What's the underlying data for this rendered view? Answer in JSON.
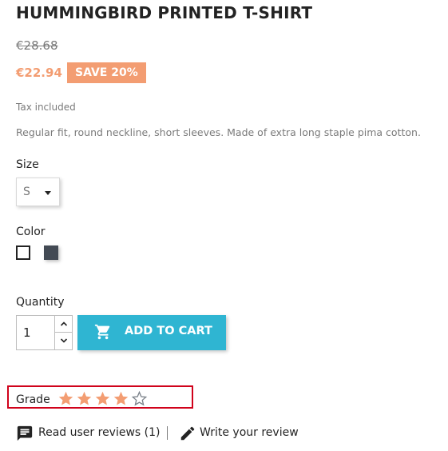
{
  "product": {
    "title": "HUMMINGBIRD PRINTED T-SHIRT",
    "old_price": "€28.68",
    "price": "€22.94",
    "discount": "SAVE 20%",
    "tax_note": "Tax included",
    "description": "Regular fit, round neckline, short sleeves. Made of extra long staple pima cotton."
  },
  "size": {
    "label": "Size",
    "selected": "S"
  },
  "color": {
    "label": "Color",
    "swatches": [
      {
        "name": "white",
        "hex": "#ffffff",
        "selected": true
      },
      {
        "name": "gray",
        "hex": "#434a54",
        "selected": false
      }
    ]
  },
  "quantity": {
    "label": "Quantity",
    "value": "1"
  },
  "cart": {
    "label": "ADD TO CART",
    "icon": "shopping-cart-icon",
    "color": "#2fb5d2"
  },
  "rating": {
    "label": "Grade",
    "value": 4,
    "max": 5,
    "star_color": "#f39d72"
  },
  "reviews": {
    "read_label": "Read user reviews (1)",
    "write_label": "Write your review",
    "read_icon": "comment-icon",
    "write_icon": "pencil-icon"
  },
  "colors": {
    "accent": "#2fb5d2",
    "discount": "#f39d72",
    "highlight_border": "#d0021b"
  }
}
